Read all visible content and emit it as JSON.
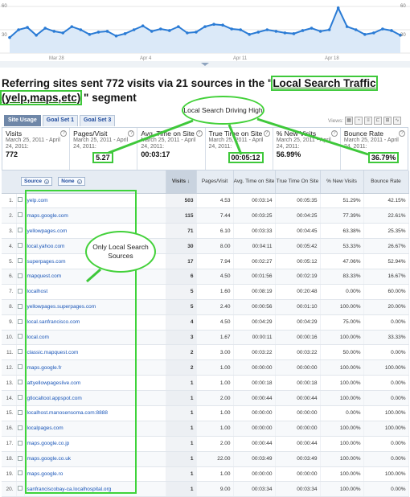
{
  "timeline": {
    "y_ticks": [
      "60",
      "30",
      "60",
      "30"
    ],
    "x_labels": [
      "Mar 28",
      "Apr 4",
      "Apr 11",
      "Apr 18"
    ],
    "series_color": "#2a7bd5",
    "points": [
      20,
      30,
      33,
      23,
      32,
      28,
      26,
      34,
      30,
      24,
      27,
      28,
      22,
      25,
      30,
      35,
      28,
      31,
      29,
      34,
      26,
      27,
      34,
      37,
      36,
      31,
      30,
      24,
      27,
      30,
      28,
      26,
      25,
      29,
      32,
      28,
      30,
      58,
      34,
      30,
      24,
      26,
      31,
      29,
      23
    ]
  },
  "headline": {
    "prefix": "Referring sites sent 772 visits via 21 sources in the \"",
    "segment": "Local Search Traffic (yelp,maps,etc)",
    "suffix": " \" segment"
  },
  "callouts": {
    "local_search": "Local Search Driving High",
    "only_local": "Only Local Search Sources"
  },
  "tabs": [
    "Site Usage",
    "Goal Set 1",
    "Goal Set 3"
  ],
  "views_label": "Views:",
  "metrics": [
    {
      "title": "Visits",
      "sub": "March 25, 2011 - April 24, 2011:",
      "value": "772"
    },
    {
      "title": "Pages/Visit",
      "sub": "March 25, 2011 - April 24, 2011:",
      "value": "5.27"
    },
    {
      "title": "Avg. Time on Site",
      "sub": "March 25, 2011 - April 24, 2011:",
      "value": "00:03:17"
    },
    {
      "title": "True Time on Site",
      "sub": "March 25, 2011 - April 24, 2011:",
      "value": "00:05:12"
    },
    {
      "title": "% New Visits",
      "sub": "March 25, 2011 - April 24, 2011:",
      "value": "56.99%"
    },
    {
      "title": "Bounce Rate",
      "sub": "March 25, 2011 - April 24, 2011:",
      "value": "36.79%"
    }
  ],
  "table": {
    "source_dropdown": "Source",
    "secondary_dropdown": "None",
    "headers": [
      "Visits ↓",
      "Pages/Visit",
      "Avg. Time on Site",
      "True Time On Site",
      "% New Visits",
      "Bounce Rate"
    ],
    "rows": [
      [
        "1.",
        "yelp.com",
        "503",
        "4.53",
        "00:03:14",
        "00:05:35",
        "51.29%",
        "42.15%"
      ],
      [
        "2.",
        "maps.google.com",
        "115",
        "7.44",
        "00:03:25",
        "00:04:25",
        "77.39%",
        "22.61%"
      ],
      [
        "3.",
        "yellowpages.com",
        "71",
        "6.10",
        "00:03:33",
        "00:04:45",
        "63.38%",
        "25.35%"
      ],
      [
        "4.",
        "local.yahoo.com",
        "30",
        "8.00",
        "00:04:11",
        "00:05:42",
        "53.33%",
        "26.67%"
      ],
      [
        "5.",
        "superpages.com",
        "17",
        "7.94",
        "00:02:27",
        "00:05:12",
        "47.06%",
        "52.94%"
      ],
      [
        "6.",
        "mapquest.com",
        "6",
        "4.50",
        "00:01:56",
        "00:02:19",
        "83.33%",
        "16.67%"
      ],
      [
        "7.",
        "localhost",
        "5",
        "1.60",
        "00:08:19",
        "00:20:48",
        "0.00%",
        "60.00%"
      ],
      [
        "8.",
        "yellowpages.superpages.com",
        "5",
        "2.40",
        "00:00:56",
        "00:01:10",
        "100.00%",
        "20.00%"
      ],
      [
        "9.",
        "local.sanfrancisco.com",
        "4",
        "4.50",
        "00:04:29",
        "00:04:29",
        "75.00%",
        "0.00%"
      ],
      [
        "10.",
        "local.com",
        "3",
        "1.67",
        "00:00:11",
        "00:00:16",
        "100.00%",
        "33.33%"
      ],
      [
        "11.",
        "classic.mapquest.com",
        "2",
        "3.00",
        "00:03:22",
        "00:03:22",
        "50.00%",
        "0.00%"
      ],
      [
        "12.",
        "maps.google.fr",
        "2",
        "1.00",
        "00:00:00",
        "00:00:00",
        "100.00%",
        "100.00%"
      ],
      [
        "13.",
        "attyellowpageslive.com",
        "1",
        "1.00",
        "00:00:18",
        "00:00:18",
        "100.00%",
        "0.00%"
      ],
      [
        "14.",
        "gtlocaltool.appspot.com",
        "1",
        "2.00",
        "00:00:44",
        "00:00:44",
        "100.00%",
        "0.00%"
      ],
      [
        "15.",
        "localhost.manosensoma.com:8888",
        "1",
        "1.00",
        "00:00:00",
        "00:00:00",
        "0.00%",
        "100.00%"
      ],
      [
        "16.",
        "localpages.com",
        "1",
        "1.00",
        "00:00:00",
        "00:00:00",
        "100.00%",
        "100.00%"
      ],
      [
        "17.",
        "maps.google.co.jp",
        "1",
        "2.00",
        "00:00:44",
        "00:00:44",
        "100.00%",
        "0.00%"
      ],
      [
        "18.",
        "maps.google.co.uk",
        "1",
        "22.00",
        "00:03:49",
        "00:03:49",
        "100.00%",
        "0.00%"
      ],
      [
        "19.",
        "maps.google.ro",
        "1",
        "1.00",
        "00:00:00",
        "00:00:00",
        "100.00%",
        "100.00%"
      ],
      [
        "20.",
        "sanfranciscobay-ca.localhospital.org",
        "1",
        "9.00",
        "00:03:34",
        "00:03:34",
        "100.00%",
        "0.00%"
      ]
    ]
  }
}
